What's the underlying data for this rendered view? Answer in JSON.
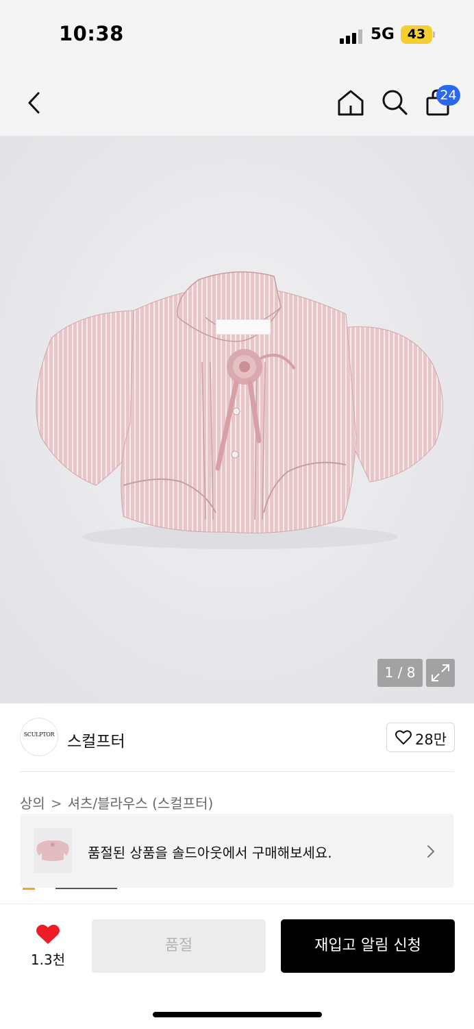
{
  "status_bar": {
    "time": "10:38",
    "network": "5G",
    "battery": "43"
  },
  "nav": {
    "cart_count": "24"
  },
  "gallery": {
    "counter": "1 / 8",
    "product_image": "pink-striped-cropped-blouse-with-rosette"
  },
  "brand": {
    "logo_text": "SCULPTOR",
    "name": "스컬프터",
    "likes": "28만"
  },
  "breadcrumb": {
    "level1": "상의",
    "separator": ">",
    "level2": "셔츠/블라우스 (스컬프터)"
  },
  "soldout_banner": {
    "text": "품절된 상품을 솔드아웃에서 구매해보세요."
  },
  "bottom": {
    "wishlist_count": "1.3천",
    "soldout_label": "품절",
    "restock_label": "재입고 알림 신청"
  },
  "colors": {
    "accent_blue": "#2a68f0",
    "heart_red": "#ee1c24",
    "battery_yellow": "#f5cf32"
  }
}
